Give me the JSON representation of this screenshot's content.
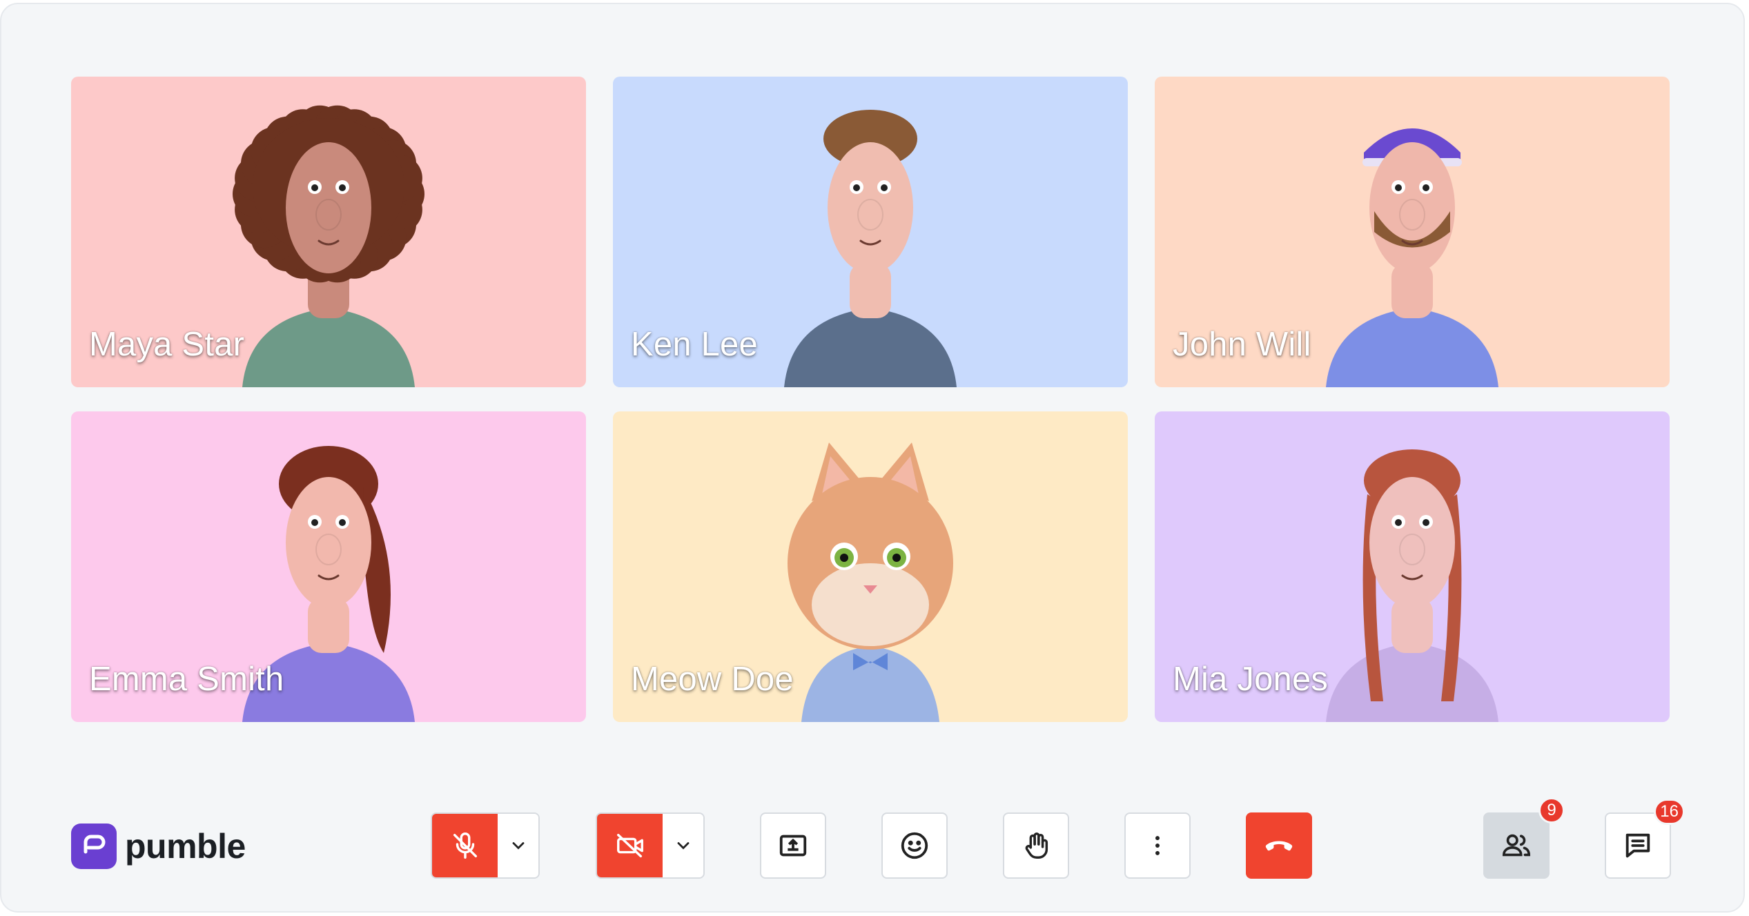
{
  "app": {
    "name": "pumble"
  },
  "participants": [
    {
      "name": "Maya Star",
      "bg": "#fdc9c9",
      "skin": "#c98a7c",
      "hair": "#6b3320",
      "shirt": "#6e9a88",
      "type": "curly"
    },
    {
      "name": "Ken Lee",
      "bg": "#c8dafd",
      "skin": "#f0bdb0",
      "hair": "#8a5a36",
      "shirt": "#5b6f8c",
      "type": "short"
    },
    {
      "name": "John Will",
      "bg": "#fed9c5",
      "skin": "#efb7ab",
      "hair": "#6a4ad0",
      "shirt": "#7d8fe6",
      "type": "cap"
    },
    {
      "name": "Emma Smith",
      "bg": "#fdc9ec",
      "skin": "#f2b8ad",
      "hair": "#7b2f1f",
      "shirt": "#8a7be0",
      "type": "ponytail"
    },
    {
      "name": "Meow Doe",
      "bg": "#feeac5",
      "skin": "#e7a57a",
      "hair": "#e7a57a",
      "shirt": "#9cb4e4",
      "type": "cat"
    },
    {
      "name": "Mia Jones",
      "bg": "#dfc9fc",
      "skin": "#efc0bd",
      "hair": "#b8553e",
      "shirt": "#c6aee6",
      "type": "braids"
    }
  ],
  "controls": {
    "mic": {
      "state": "muted",
      "color": "#f0442f"
    },
    "camera": {
      "state": "off",
      "color": "#f0442f"
    },
    "share_screen": "share-screen",
    "reactions": "emoji",
    "raise_hand": "hand",
    "more": "more",
    "end_call": {
      "color": "#f0442f"
    },
    "participants_badge": "9",
    "chat_badge": "16"
  }
}
